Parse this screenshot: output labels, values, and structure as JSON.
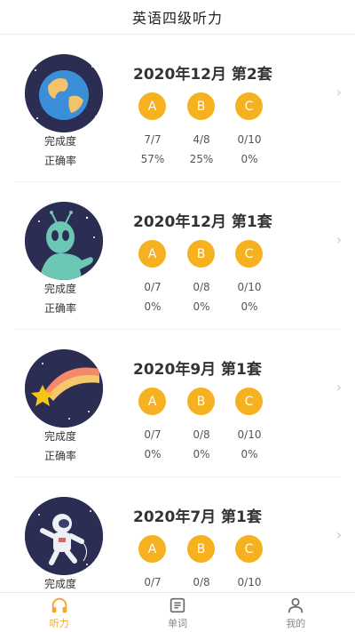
{
  "header": {
    "title": "英语四级听力"
  },
  "labels": {
    "completion": "完成度",
    "accuracy": "正确率"
  },
  "chevron": "›",
  "cards": [
    {
      "icon": "earth-icon",
      "title": "2020年12月  第2套",
      "buttons": [
        "A",
        "B",
        "C"
      ],
      "completion": [
        "7/7",
        "4/8",
        "0/10"
      ],
      "accuracy": [
        "57%",
        "25%",
        "0%"
      ]
    },
    {
      "icon": "alien-icon",
      "title": "2020年12月  第1套",
      "buttons": [
        "A",
        "B",
        "C"
      ],
      "completion": [
        "0/7",
        "0/8",
        "0/10"
      ],
      "accuracy": [
        "0%",
        "0%",
        "0%"
      ]
    },
    {
      "icon": "shooting-star-icon",
      "title": "2020年9月  第1套",
      "buttons": [
        "A",
        "B",
        "C"
      ],
      "completion": [
        "0/7",
        "0/8",
        "0/10"
      ],
      "accuracy": [
        "0%",
        "0%",
        "0%"
      ]
    },
    {
      "icon": "astronaut-icon",
      "title": "2020年7月  第1套",
      "buttons": [
        "A",
        "B",
        "C"
      ],
      "completion": [
        "0/7",
        "0/8",
        "0/10"
      ],
      "accuracy": []
    }
  ],
  "tabbar": {
    "items": [
      {
        "label": "听力",
        "icon": "headphones-icon",
        "active": true
      },
      {
        "label": "单词",
        "icon": "book-icon",
        "active": false
      },
      {
        "label": "我的",
        "icon": "user-icon",
        "active": false
      }
    ]
  },
  "colors": {
    "accent": "#f5b120",
    "tab_active": "#f5a623",
    "avatar_bg": "#2b2d52"
  }
}
